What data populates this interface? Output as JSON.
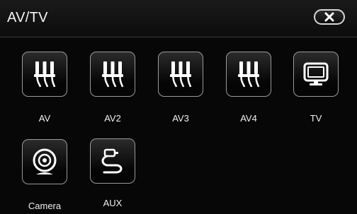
{
  "header": {
    "title": "AV/TV",
    "close_icon": "close-x-icon"
  },
  "apps": [
    {
      "label": "AV",
      "icon": "rca-plugs-icon"
    },
    {
      "label": "AV2",
      "icon": "rca-plugs-icon"
    },
    {
      "label": "AV3",
      "icon": "rca-plugs-icon"
    },
    {
      "label": "AV4",
      "icon": "rca-plugs-icon"
    },
    {
      "label": "TV",
      "icon": "tv-monitor-icon"
    },
    {
      "label": "Camera",
      "icon": "webcam-icon"
    },
    {
      "label": "AUX",
      "icon": "aux-cable-icon"
    }
  ],
  "colors": {
    "background": "#070707",
    "tile_border": "#9a9a9a",
    "text": "#f0f0f0"
  }
}
